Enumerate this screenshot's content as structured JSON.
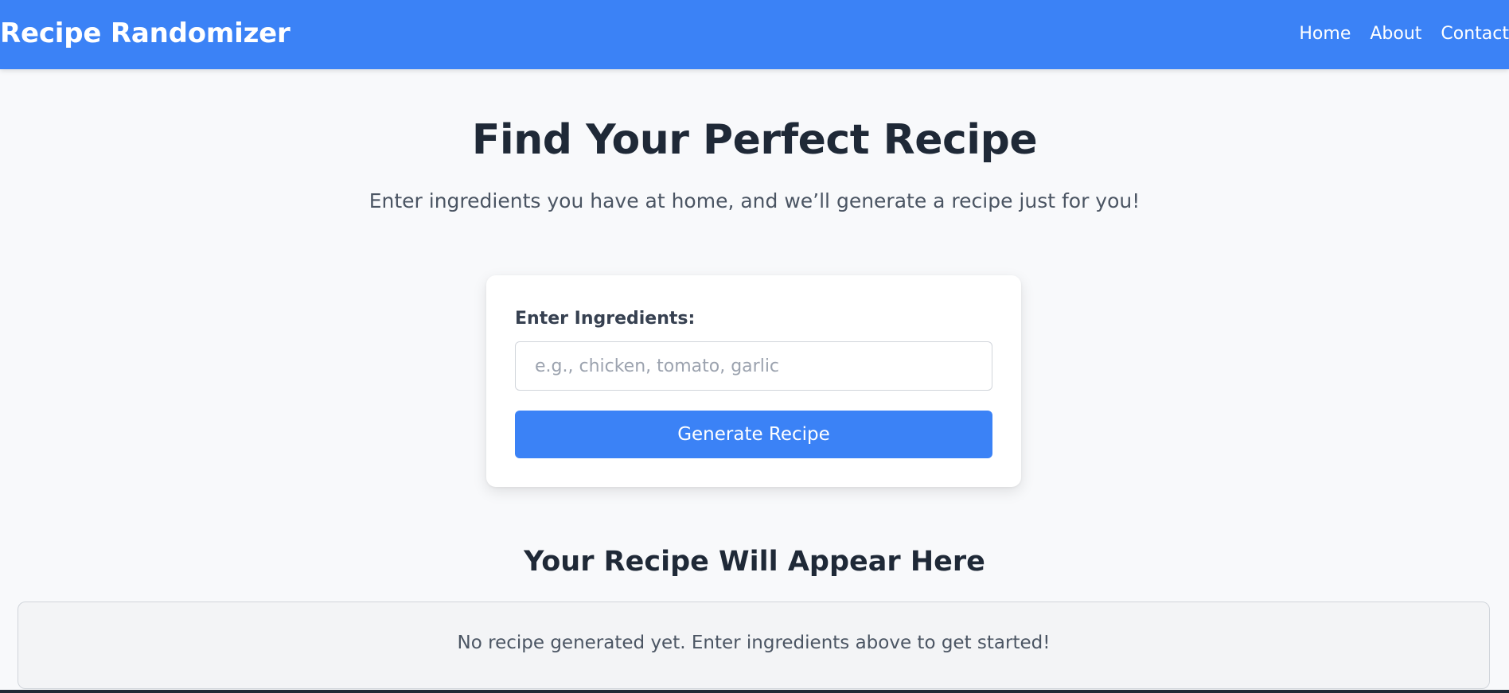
{
  "header": {
    "brand": "Recipe Randomizer",
    "nav": [
      {
        "label": "Home"
      },
      {
        "label": "About"
      },
      {
        "label": "Contact"
      }
    ]
  },
  "hero": {
    "title": "Find Your Perfect Recipe",
    "subtitle": "Enter ingredients you have at home, and we’ll generate a recipe just for you!"
  },
  "form": {
    "label": "Enter Ingredients:",
    "input_value": "",
    "input_placeholder": "e.g., chicken, tomato, garlic",
    "button_label": "Generate Recipe"
  },
  "result": {
    "heading": "Your Recipe Will Appear Here",
    "placeholder": "No recipe generated yet. Enter ingredients above to get started!"
  },
  "colors": {
    "primary": "#3b82f6",
    "background": "#f8f9fb",
    "text": "#1f2937"
  }
}
